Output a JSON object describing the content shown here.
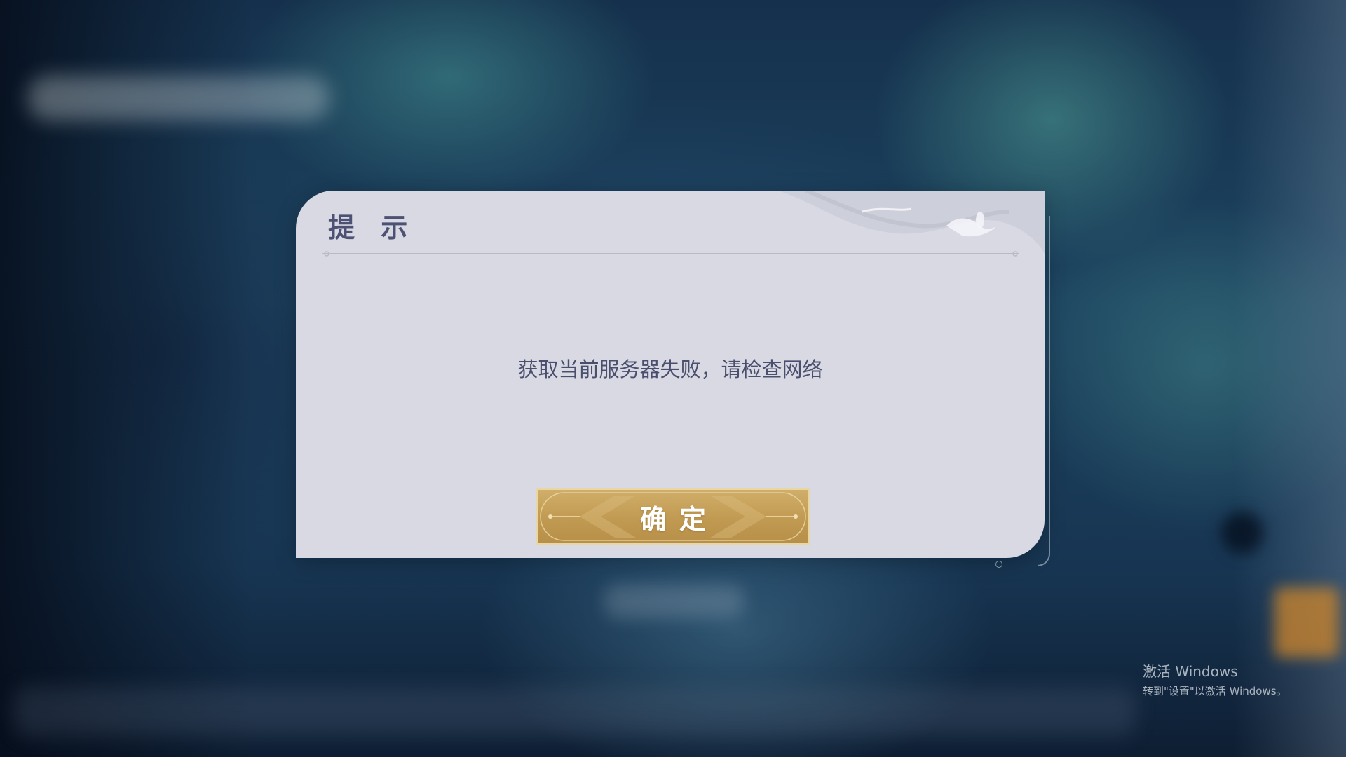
{
  "dialog": {
    "title": "提 示",
    "message": "获取当前服务器失败，请检查网络",
    "confirm_label": "确定"
  },
  "watermark": {
    "title": "激活 Windows",
    "subtitle": "转到\"设置\"以激活 Windows。"
  },
  "colors": {
    "dialog_bg": "#d8d9e3",
    "title_text": "#4d5173",
    "message_text": "#4b4f6e",
    "button_gold": "#c19a52",
    "button_border": "#e9d6a5"
  }
}
